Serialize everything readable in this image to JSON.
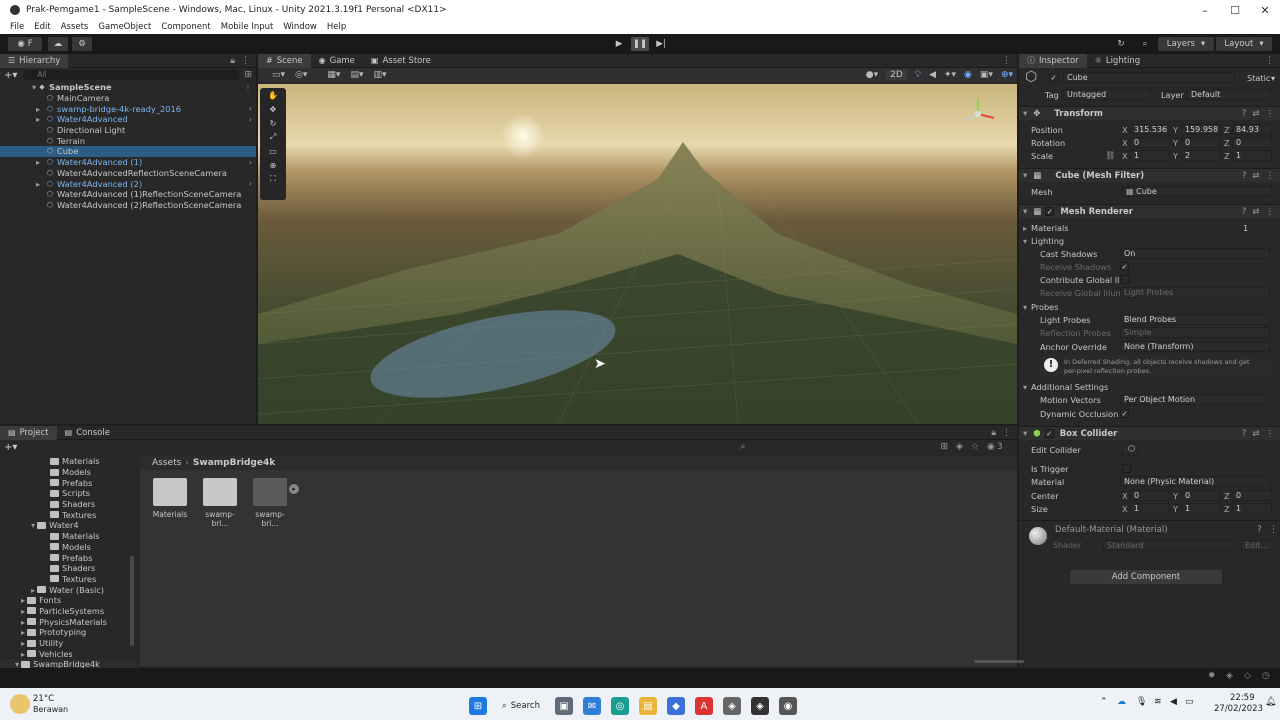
{
  "window": {
    "title": "Prak-Pemgame1 - SampleScene - Windows, Mac, Linux - Unity 2021.3.19f1 Personal <DX11>",
    "controls": [
      "–",
      "☐",
      "✕"
    ]
  },
  "menu": [
    "File",
    "Edit",
    "Assets",
    "GameObject",
    "Component",
    "Mobile Input",
    "Window",
    "Help"
  ],
  "toolbar": {
    "account": "F",
    "layers_label": "Layers",
    "layout_label": "Layout"
  },
  "hierarchy": {
    "tab_label": "Hierarchy",
    "search_placeholder": "All",
    "scene": "SampleScene",
    "items": [
      {
        "label": "MainCamera",
        "prefab": false,
        "selected": false
      },
      {
        "label": "swamp-bridge-4k-ready_2016",
        "prefab": true,
        "selected": false
      },
      {
        "label": "Water4Advanced",
        "prefab": true,
        "selected": false
      },
      {
        "label": "Directional Light",
        "prefab": false,
        "selected": false
      },
      {
        "label": "Terrain",
        "prefab": false,
        "selected": false
      },
      {
        "label": "Cube",
        "prefab": false,
        "selected": true
      },
      {
        "label": "Water4Advanced (1)",
        "prefab": true,
        "selected": false
      },
      {
        "label": "Water4AdvancedReflectionSceneCamera",
        "prefab": false,
        "selected": false
      },
      {
        "label": "Water4Advanced (2)",
        "prefab": true,
        "selected": false
      },
      {
        "label": "Water4Advanced (1)ReflectionSceneCamera",
        "prefab": false,
        "selected": false
      },
      {
        "label": "Water4Advanced (2)ReflectionSceneCamera",
        "prefab": false,
        "selected": false
      }
    ]
  },
  "scene_tabs": [
    "Scene",
    "Game",
    "Asset Store"
  ],
  "scene_toolbar": {
    "mode_2d": "2D"
  },
  "inspector": {
    "tabs": [
      "Inspector",
      "Lighting"
    ],
    "object_name": "Cube",
    "static_label": "Static",
    "tag_label": "Tag",
    "tag_value": "Untagged",
    "layer_label": "Layer",
    "layer_value": "Default",
    "transform": {
      "title": "Transform",
      "position_label": "Position",
      "position": {
        "x": "315.536",
        "y": "159.958",
        "z": "84.93"
      },
      "rotation_label": "Rotation",
      "rotation": {
        "x": "0",
        "y": "0",
        "z": "0"
      },
      "scale_label": "Scale",
      "scale": {
        "x": "1",
        "y": "2",
        "z": "1"
      }
    },
    "mesh_filter": {
      "title": "Cube (Mesh Filter)",
      "mesh_label": "Mesh",
      "mesh_value": "Cube"
    },
    "mesh_renderer": {
      "title": "Mesh Renderer",
      "materials_label": "Materials",
      "materials_count": "1",
      "lighting_label": "Lighting",
      "cast_shadows_label": "Cast Shadows",
      "cast_shadows_value": "On",
      "receive_shadows_label": "Receive Shadows",
      "contribute_gi_label": "Contribute Global Illu",
      "receive_gi_label": "Receive Global Illumi",
      "receive_gi_value": "Light Probes",
      "probes_label": "Probes",
      "light_probes_label": "Light Probes",
      "light_probes_value": "Blend Probes",
      "reflection_probes_label": "Reflection Probes",
      "reflection_probes_value": "Simple",
      "anchor_override_label": "Anchor Override",
      "anchor_override_value": "None (Transform)",
      "info_text_1": "In Deferred Shading, all objects receive shadows and get",
      "info_text_2": "per-pixel reflection probes.",
      "additional_settings_label": "Additional Settings",
      "motion_vectors_label": "Motion Vectors",
      "motion_vectors_value": "Per Object Motion",
      "dynamic_occlusion_label": "Dynamic Occlusion"
    },
    "box_collider": {
      "title": "Box Collider",
      "edit_collider_label": "Edit Collider",
      "is_trigger_label": "Is Trigger",
      "material_label": "Material",
      "material_value": "None (Physic Material)",
      "center_label": "Center",
      "center": {
        "x": "0",
        "y": "0",
        "z": "0"
      },
      "size_label": "Size",
      "size": {
        "x": "1",
        "y": "1",
        "z": "1"
      }
    },
    "material": {
      "name": "Default-Material (Material)",
      "shader_label": "Shader",
      "shader_value": "Standard",
      "edit_label": "Edit..."
    },
    "add_component_label": "Add Component"
  },
  "project": {
    "tabs": [
      "Project",
      "Console"
    ],
    "breadcrumb": [
      "Assets",
      "SwampBridge4k"
    ],
    "tree": [
      {
        "label": "Materials",
        "indent": 2
      },
      {
        "label": "Models",
        "indent": 2
      },
      {
        "label": "Prefabs",
        "indent": 2
      },
      {
        "label": "Scripts",
        "indent": 2
      },
      {
        "label": "Shaders",
        "indent": 2
      },
      {
        "label": "Textures",
        "indent": 2
      },
      {
        "label": "Water4",
        "indent": 1
      },
      {
        "label": "Materials",
        "indent": 2
      },
      {
        "label": "Models",
        "indent": 2
      },
      {
        "label": "Prefabs",
        "indent": 2
      },
      {
        "label": "Shaders",
        "indent": 2
      },
      {
        "label": "Textures",
        "indent": 2
      },
      {
        "label": "Water (Basic)",
        "indent": 1
      },
      {
        "label": "Fonts",
        "indent": 0
      },
      {
        "label": "ParticleSystems",
        "indent": 0
      },
      {
        "label": "PhysicsMaterials",
        "indent": 0
      },
      {
        "label": "Prototyping",
        "indent": 0
      },
      {
        "label": "Utility",
        "indent": 0
      },
      {
        "label": "Vehicles",
        "indent": 0
      },
      {
        "label": "SwampBridge4k",
        "indent": -1
      }
    ],
    "assets": [
      {
        "label": "Materials",
        "kind": "folder"
      },
      {
        "label": "swamp-bri...",
        "kind": "folder"
      },
      {
        "label": "swamp-bri...",
        "kind": "model"
      }
    ],
    "hidden_count": "3"
  },
  "taskbar": {
    "weather_temp": "21°C",
    "weather_desc": "Berawan",
    "search_label": "Search",
    "time": "22:59",
    "date": "27/02/2023"
  },
  "colors": {
    "selected": "#2c5d87",
    "prefab_text": "#7fb6ef",
    "panel": "#282828"
  }
}
